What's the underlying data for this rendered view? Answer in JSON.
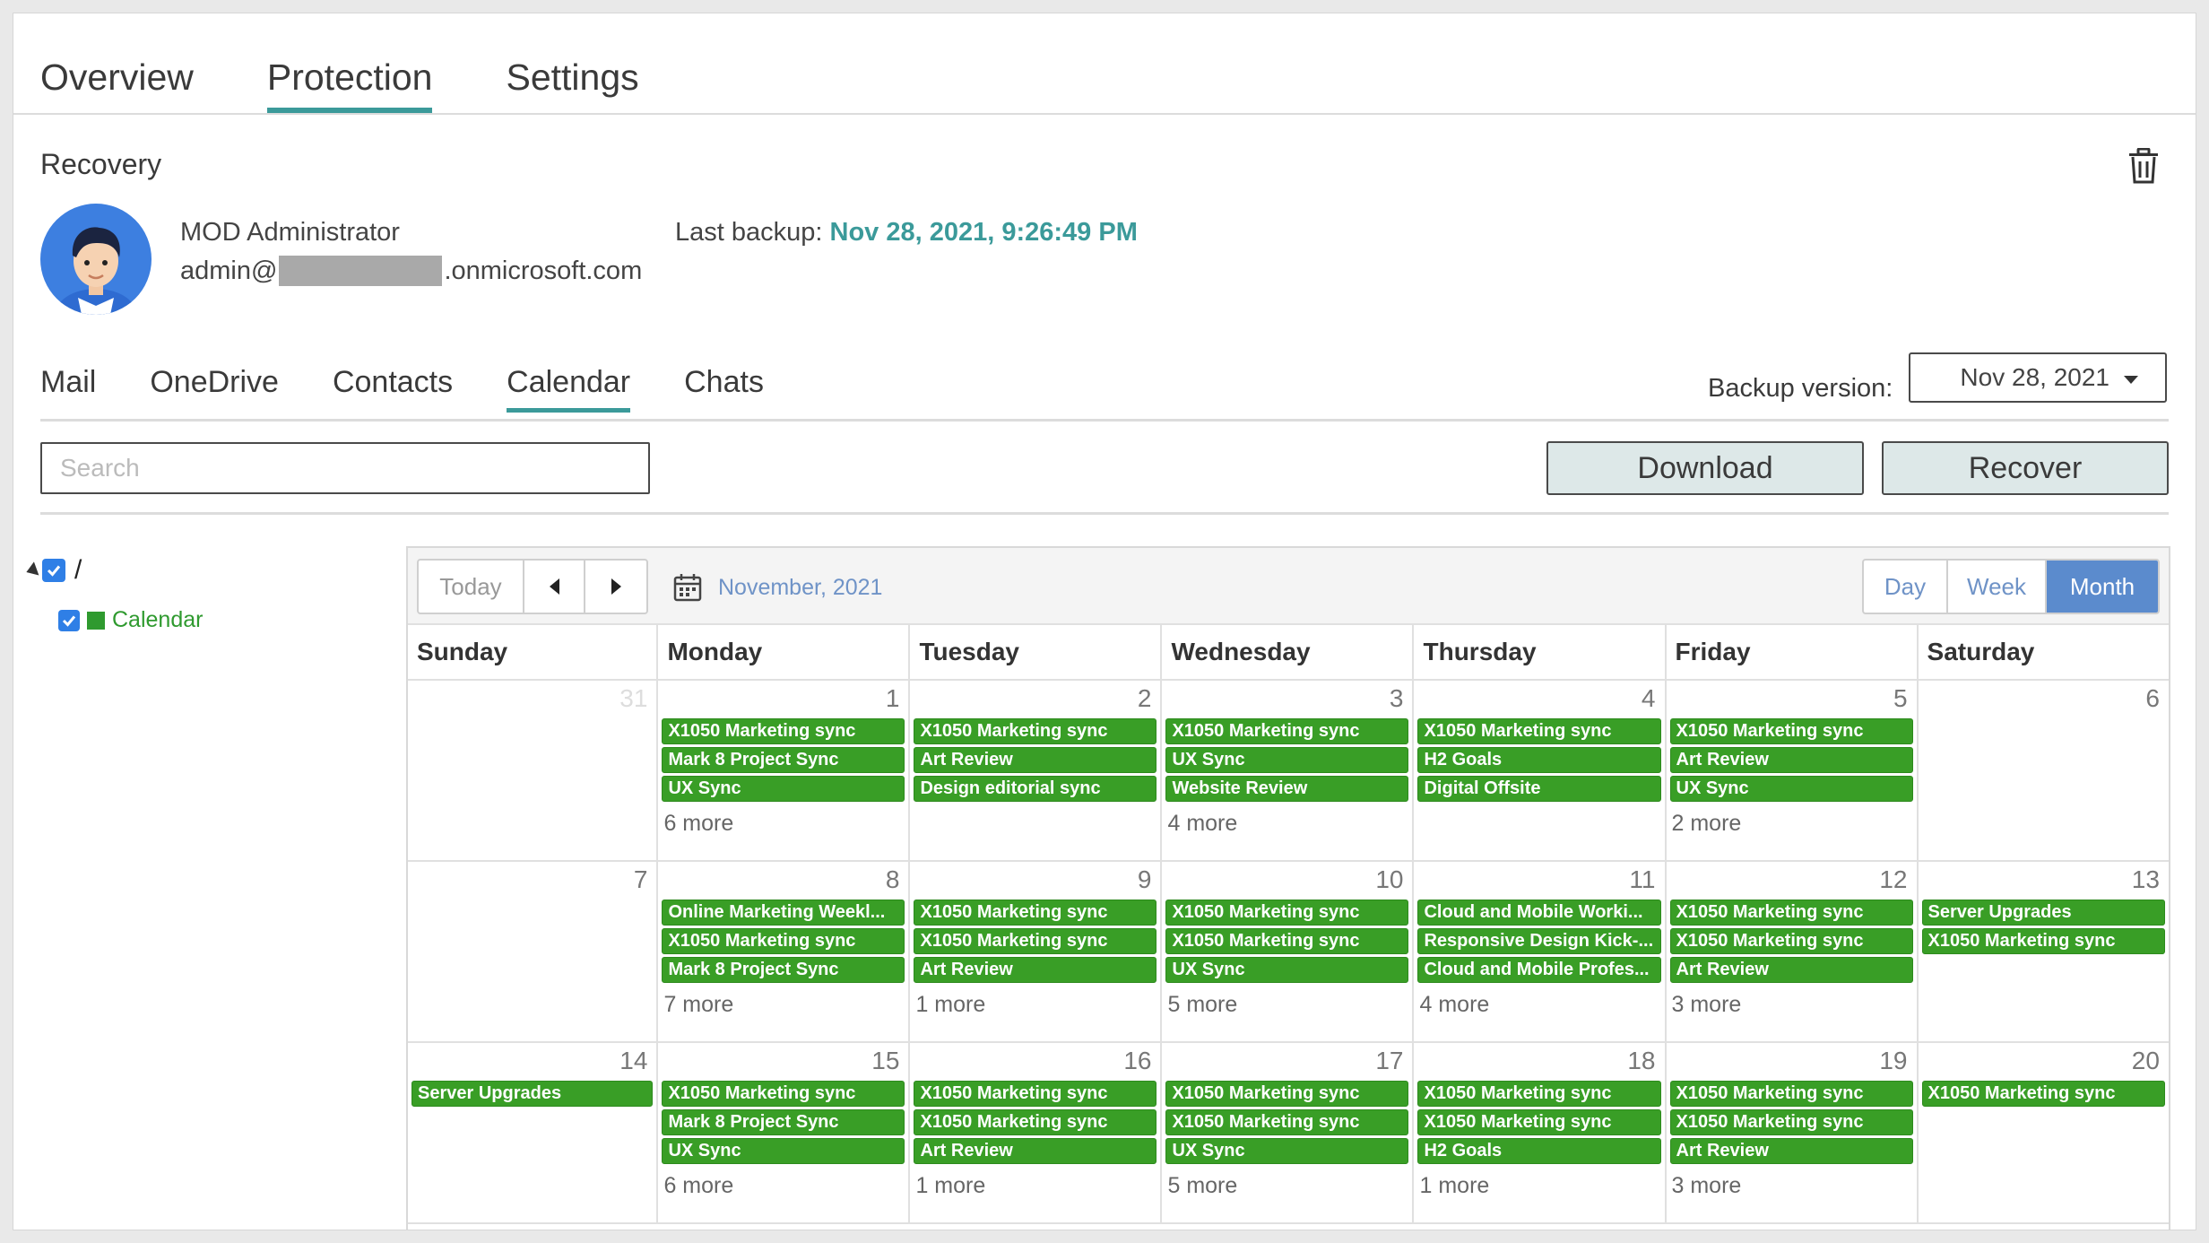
{
  "top_tabs": [
    "Overview",
    "Protection",
    "Settings"
  ],
  "section_title": "Recovery",
  "user": {
    "name": "MOD Administrator",
    "email_prefix": "admin@",
    "email_suffix": ".onmicrosoft.com"
  },
  "last_backup": {
    "label": "Last backup:",
    "value": "Nov 28, 2021, 9:26:49 PM"
  },
  "sub_tabs": [
    "Mail",
    "OneDrive",
    "Contacts",
    "Calendar",
    "Chats"
  ],
  "backup_version": {
    "label": "Backup version:",
    "value": "Nov 28, 2021"
  },
  "search": {
    "placeholder": "Search"
  },
  "buttons": {
    "download": "Download",
    "recover": "Recover"
  },
  "tree": {
    "root_label": "/",
    "child_label": "Calendar"
  },
  "calendar": {
    "today": "Today",
    "month_label": "November, 2021",
    "views": [
      "Day",
      "Week",
      "Month"
    ],
    "active_view": "Month",
    "days_of_week": [
      "Sunday",
      "Monday",
      "Tuesday",
      "Wednesday",
      "Thursday",
      "Friday",
      "Saturday"
    ],
    "weeks": [
      [
        {
          "day": "31",
          "muted": true,
          "events": [],
          "more": ""
        },
        {
          "day": "1",
          "events": [
            "X1050 Marketing sync",
            "Mark 8 Project Sync",
            "UX Sync"
          ],
          "more": "6 more"
        },
        {
          "day": "2",
          "events": [
            "X1050 Marketing sync",
            "Art Review",
            "Design editorial sync"
          ],
          "more": ""
        },
        {
          "day": "3",
          "events": [
            "X1050 Marketing sync",
            "UX Sync",
            "Website Review"
          ],
          "more": "4 more"
        },
        {
          "day": "4",
          "events": [
            "X1050 Marketing sync",
            "H2 Goals",
            "Digital Offsite"
          ],
          "more": ""
        },
        {
          "day": "5",
          "events": [
            "X1050 Marketing sync",
            "Art Review",
            "UX Sync"
          ],
          "more": "2 more"
        },
        {
          "day": "6",
          "events": [],
          "more": ""
        }
      ],
      [
        {
          "day": "7",
          "events": [],
          "more": ""
        },
        {
          "day": "8",
          "events": [
            "Online Marketing Weekl...",
            "X1050 Marketing sync",
            "Mark 8 Project Sync"
          ],
          "more": "7 more"
        },
        {
          "day": "9",
          "events": [
            "X1050 Marketing sync",
            "X1050 Marketing sync",
            "Art Review"
          ],
          "more": "1 more"
        },
        {
          "day": "10",
          "events": [
            "X1050 Marketing sync",
            "X1050 Marketing sync",
            "UX Sync"
          ],
          "more": "5 more"
        },
        {
          "day": "11",
          "events": [
            "Cloud and Mobile Worki...",
            "Responsive Design Kick-...",
            "Cloud and Mobile Profes..."
          ],
          "more": "4 more"
        },
        {
          "day": "12",
          "events": [
            "X1050 Marketing sync",
            "X1050 Marketing sync",
            "Art Review"
          ],
          "more": "3 more"
        },
        {
          "day": "13",
          "events": [
            "Server Upgrades",
            "X1050 Marketing sync"
          ],
          "more": ""
        }
      ],
      [
        {
          "day": "14",
          "events": [
            "Server Upgrades"
          ],
          "more": ""
        },
        {
          "day": "15",
          "events": [
            "X1050 Marketing sync",
            "Mark 8 Project Sync",
            "UX Sync"
          ],
          "more": "6 more"
        },
        {
          "day": "16",
          "events": [
            "X1050 Marketing sync",
            "X1050 Marketing sync",
            "Art Review"
          ],
          "more": "1 more"
        },
        {
          "day": "17",
          "events": [
            "X1050 Marketing sync",
            "X1050 Marketing sync",
            "UX Sync"
          ],
          "more": "5 more"
        },
        {
          "day": "18",
          "events": [
            "X1050 Marketing sync",
            "X1050 Marketing sync",
            "H2 Goals"
          ],
          "more": "1 more"
        },
        {
          "day": "19",
          "events": [
            "X1050 Marketing sync",
            "X1050 Marketing sync",
            "Art Review"
          ],
          "more": "3 more"
        },
        {
          "day": "20",
          "events": [
            "X1050 Marketing sync"
          ],
          "more": ""
        }
      ]
    ]
  },
  "colors": {
    "accent": "#3b9a9a",
    "event_green": "#399e26",
    "month_active": "#5b8bcd",
    "checkbox_blue": "#2f7fe6"
  }
}
